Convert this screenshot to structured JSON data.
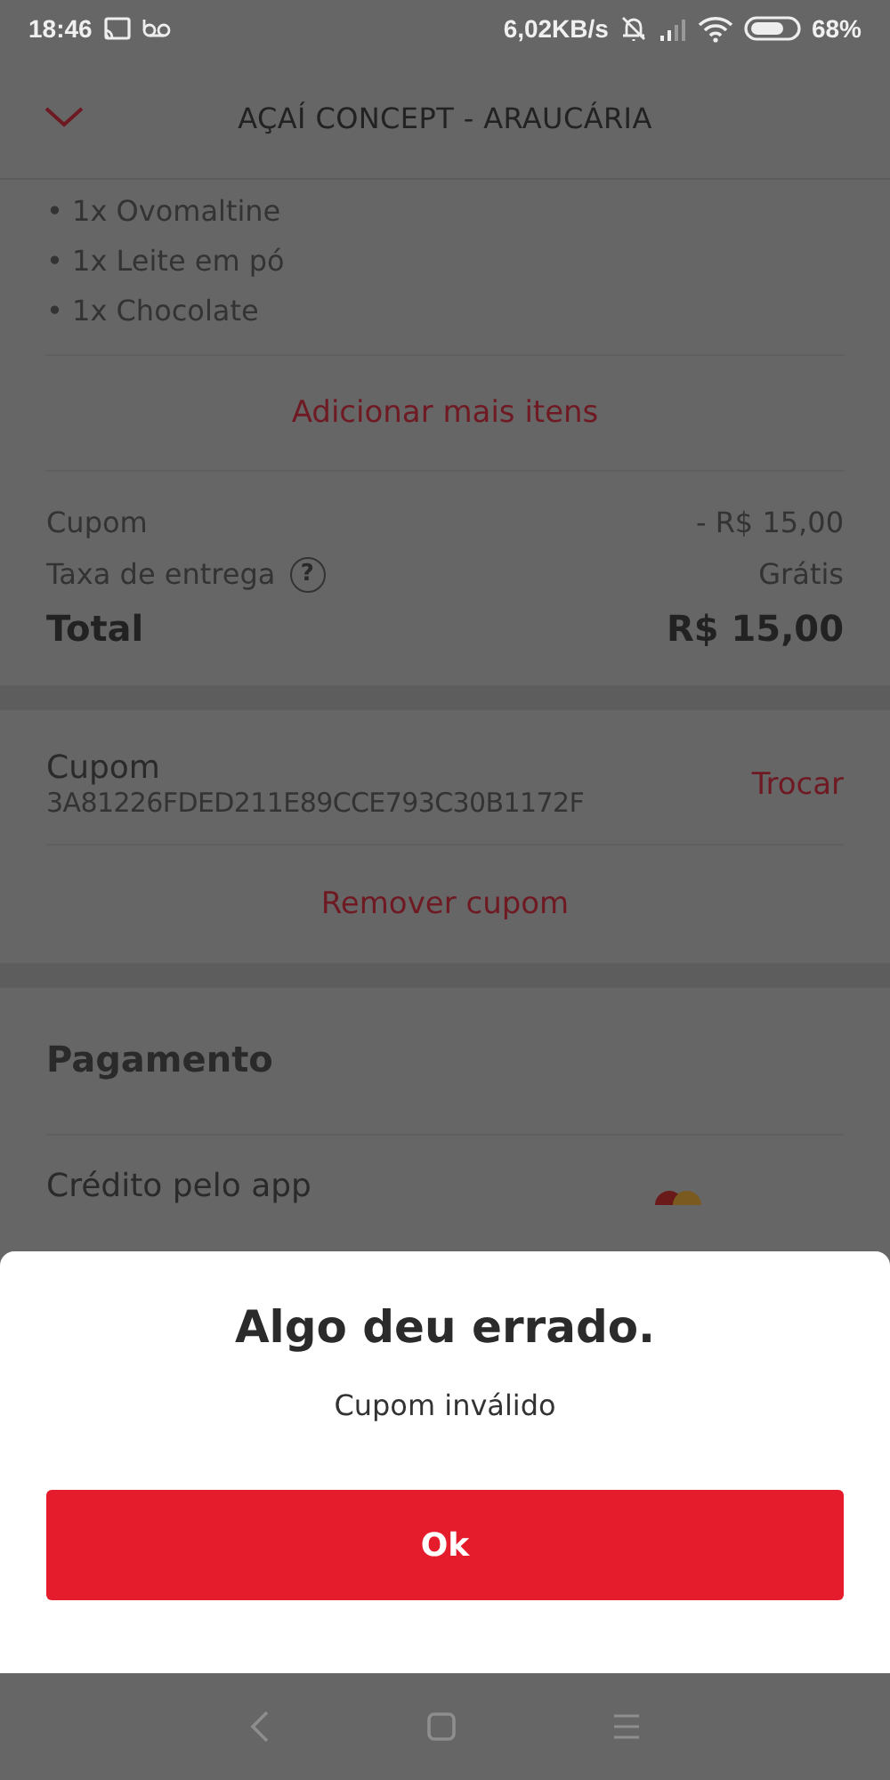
{
  "status_bar": {
    "time": "18:46",
    "network_speed": "6,02KB/s",
    "battery": "68%"
  },
  "header": {
    "title": "AÇAÍ CONCEPT - ARAUCÁRIA"
  },
  "order_items": [
    "• 1x Ovomaltine",
    "• 1x Leite em pó",
    "• 1x Chocolate"
  ],
  "add_more_link": "Adicionar mais itens",
  "summary": [
    {
      "kind": "plain",
      "label": "Cupom",
      "value": "- R$ 15,00"
    },
    {
      "kind": "help",
      "label": "Taxa de entrega",
      "help_mark": "?",
      "value": "Grátis"
    },
    {
      "kind": "total",
      "label": "Total",
      "value": "R$ 15,00"
    }
  ],
  "coupon": {
    "heading": "Cupom",
    "code": "3A81226FDED211E89CCE793C30B1172F",
    "change_link": "Trocar",
    "remove_link": "Remover cupom"
  },
  "payment": {
    "heading": "Pagamento",
    "method": "Crédito pelo app"
  },
  "dialog": {
    "title": "Algo deu errado.",
    "message": "Cupom inválido",
    "button": "Ok"
  }
}
